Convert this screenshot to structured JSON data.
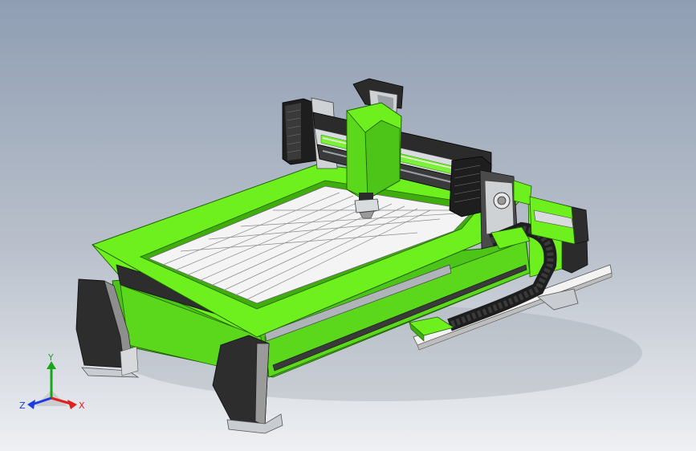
{
  "viewport": {
    "background_top": "#8f9eb3",
    "background_bottom": "#eef0f3"
  },
  "model": {
    "frame_color": "#6ef01e",
    "frame_shade": "#3fae0d",
    "dark_color": "#2a2a2a",
    "gray_color": "#bfc4c8",
    "table_color": "#f4f4f4"
  },
  "triad": {
    "x_label": "X",
    "y_label": "Y",
    "z_label": "Z",
    "x_color": "#e0201c",
    "y_color": "#1aa61a",
    "z_color": "#1c3be0"
  }
}
